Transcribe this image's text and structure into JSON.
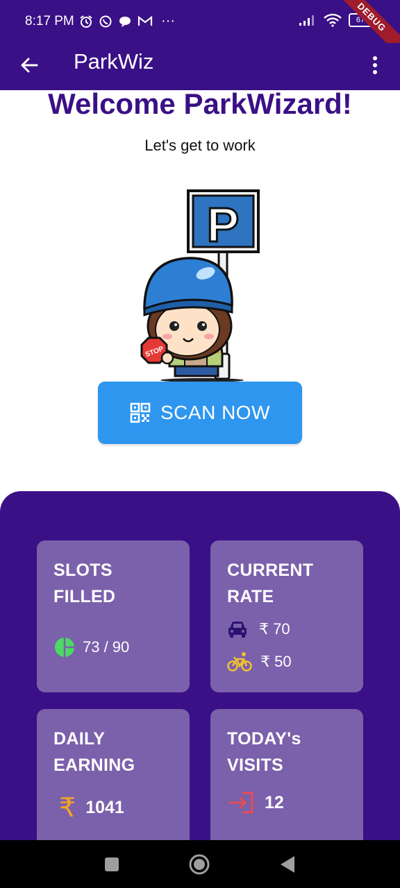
{
  "status_bar": {
    "time": "8:17 PM",
    "dots": "···",
    "battery": "67",
    "debug_banner": "DEBUG"
  },
  "app_bar": {
    "title": "ParkWiz",
    "back_icon": "arrow-back-icon",
    "menu_icon": "more-vert-icon"
  },
  "hero": {
    "welcome": "Welcome ParkWizard!",
    "tagline": "Let's get to work",
    "illustration_sign_letter": "P",
    "illustration_stop_text": "STOP"
  },
  "scan_button": {
    "label": "SCAN NOW",
    "icon": "qr-code-icon"
  },
  "cards": {
    "slots": {
      "title_line1": "SLOTS",
      "title_line2": "FILLED",
      "value": "73 / 90",
      "filled": 73,
      "total": 90
    },
    "rate": {
      "title_line1": "CURRENT",
      "title_line2": "RATE",
      "car_rate": "₹ 70",
      "bike_rate": "₹ 50"
    },
    "earning": {
      "title_line1": "DAILY",
      "title_line2": "EARNING",
      "currency": "₹",
      "value": "1041"
    },
    "visits": {
      "title_line1": "TODAY's",
      "title_line2": "VISITS",
      "value": "12"
    }
  },
  "colors": {
    "primary": "#3a1086",
    "card": "#7b60ab",
    "button": "#2f96ef",
    "pie_green": "#4cd964",
    "bike_yellow": "#f2c230",
    "rupee_orange": "#f6a623",
    "enter_red": "#ef4b4b"
  }
}
